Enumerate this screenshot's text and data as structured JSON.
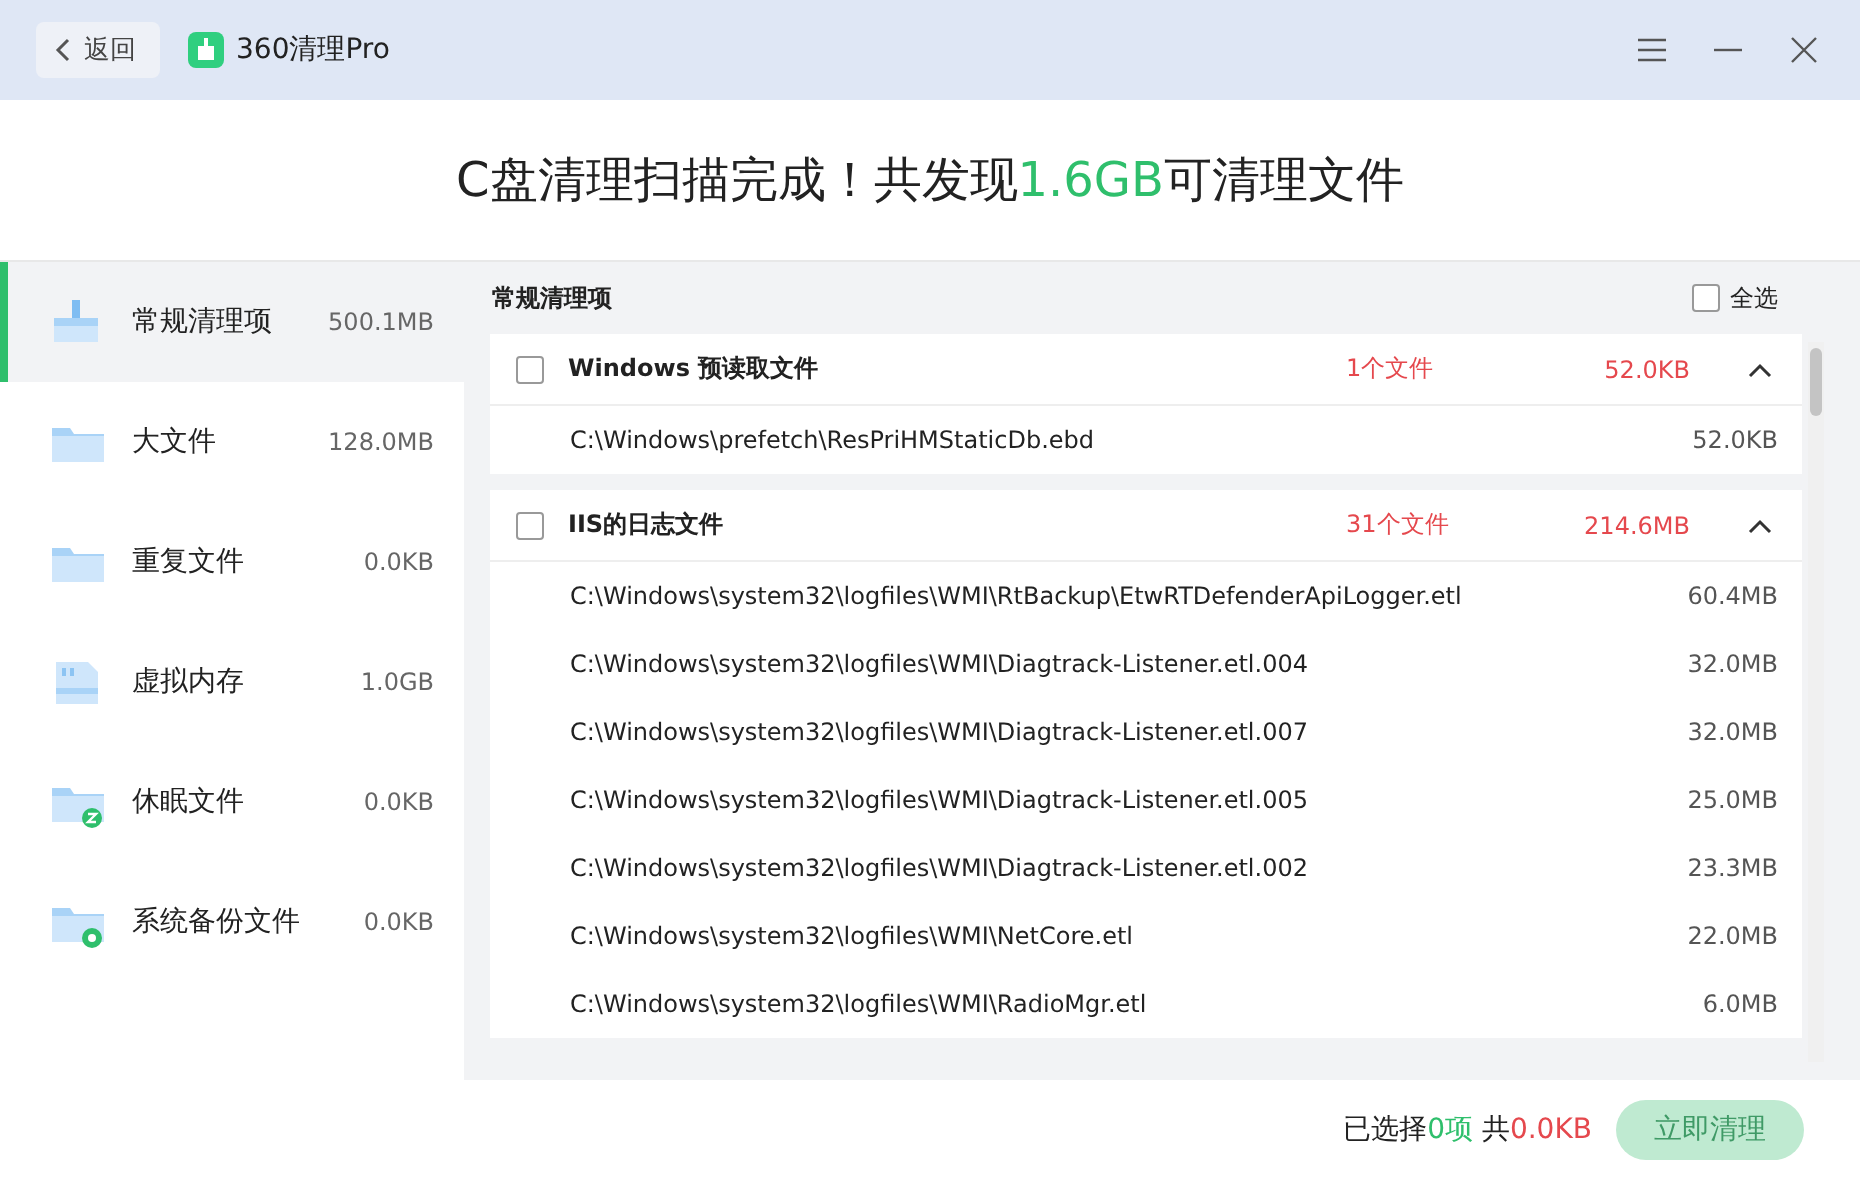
{
  "window": {
    "back": "返回",
    "app_name": "360清理Pro"
  },
  "headline": {
    "prefix": "C盘清理扫描完成！共发现",
    "highlight": "1.6GB",
    "suffix": "可清理文件"
  },
  "sidebar": {
    "items": [
      {
        "label": "常规清理项",
        "size": "500.1MB",
        "selected": true
      },
      {
        "label": "大文件",
        "size": "128.0MB",
        "selected": false
      },
      {
        "label": "重复文件",
        "size": "0.0KB",
        "selected": false
      },
      {
        "label": "虚拟内存",
        "size": "1.0GB",
        "selected": false
      },
      {
        "label": "休眠文件",
        "size": "0.0KB",
        "selected": false
      },
      {
        "label": "系统备份文件",
        "size": "0.0KB",
        "selected": false
      }
    ]
  },
  "section": {
    "title": "常规清理项",
    "select_all": {
      "label": "全选",
      "checked": false
    }
  },
  "groups": [
    {
      "title": "Windows 预读取文件",
      "count": "1个文件",
      "size": "52.0KB",
      "checked": false,
      "expanded": true,
      "files": [
        {
          "path": "C:\\Windows\\prefetch\\ResPriHMStaticDb.ebd",
          "size": "52.0KB"
        }
      ]
    },
    {
      "title": "IIS的日志文件",
      "count": "31个文件",
      "size": "214.6MB",
      "checked": false,
      "expanded": true,
      "files": [
        {
          "path": "C:\\Windows\\system32\\logfiles\\WMI\\RtBackup\\EtwRTDefenderApiLogger.etl",
          "size": "60.4MB"
        },
        {
          "path": "C:\\Windows\\system32\\logfiles\\WMI\\Diagtrack-Listener.etl.004",
          "size": "32.0MB"
        },
        {
          "path": "C:\\Windows\\system32\\logfiles\\WMI\\Diagtrack-Listener.etl.007",
          "size": "32.0MB"
        },
        {
          "path": "C:\\Windows\\system32\\logfiles\\WMI\\Diagtrack-Listener.etl.005",
          "size": "25.0MB"
        },
        {
          "path": "C:\\Windows\\system32\\logfiles\\WMI\\Diagtrack-Listener.etl.002",
          "size": "23.3MB"
        },
        {
          "path": "C:\\Windows\\system32\\logfiles\\WMI\\NetCore.etl",
          "size": "22.0MB"
        },
        {
          "path": "C:\\Windows\\system32\\logfiles\\WMI\\RadioMgr.etl",
          "size": "6.0MB"
        }
      ]
    }
  ],
  "footer": {
    "selected_prefix": "已选择",
    "selected_count": "0项",
    "total_prefix": "共",
    "total_size": "0.0KB",
    "clean_button": {
      "label": "立即清理",
      "disabled": true
    }
  }
}
